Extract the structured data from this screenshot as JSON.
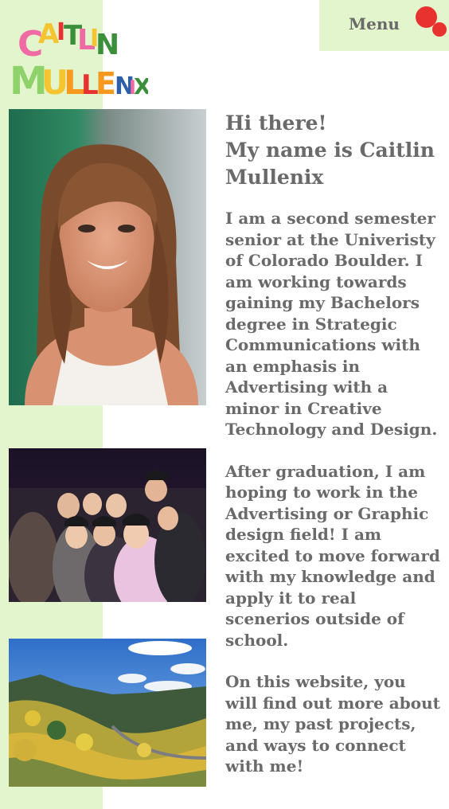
{
  "header": {
    "logo_text": "CAITLIN MULLENIX",
    "menu_label": "Menu"
  },
  "intro": {
    "heading_line1": "Hi there!",
    "heading_line2": "My name is Caitlin Mullenix",
    "paragraphs": [
      "I am a second semester senior at the Univeristy of Colorado Boulder. I am working towards gaining my Bachelors degree in Strategic Communications with an emphasis in Advertising with a minor in Creative Technology and Design.",
      "After graduation, I am hoping to work in the Advertising or Graphic design field! I am excited to move forward with my knowledge and apply it to real scenerios outside of school.",
      "On this website, you will find out more about me, my past projects, and ways to connect with me!"
    ]
  },
  "colors": {
    "accent_green": "#e3f5cc",
    "menu_dot": "#e8322f",
    "text": "#6a6a6a"
  }
}
